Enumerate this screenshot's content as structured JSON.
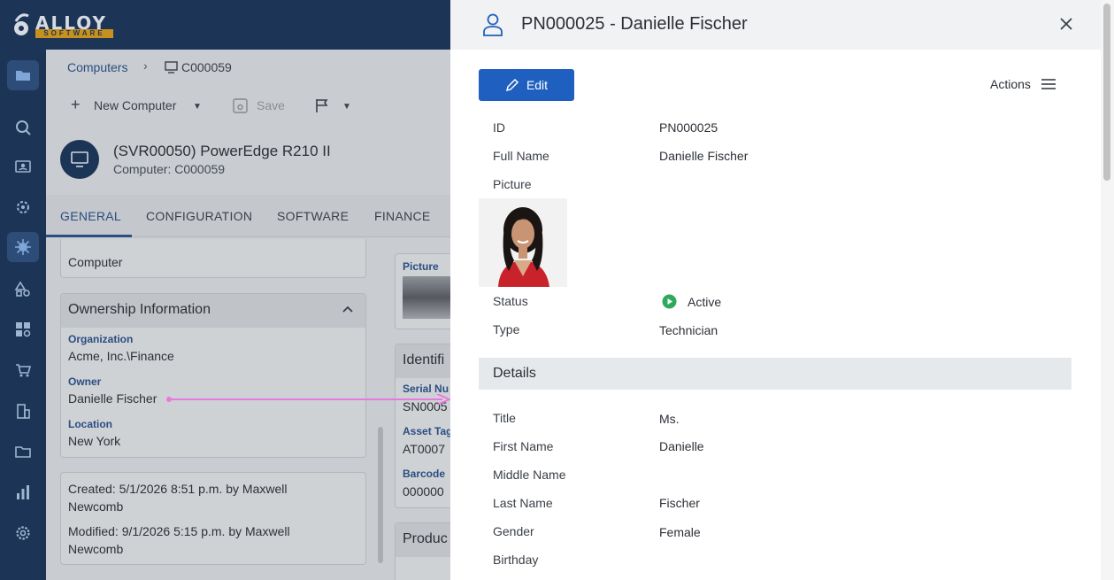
{
  "app": {
    "logo_text": "ALLOY",
    "logo_sub": "SOFTWARE"
  },
  "nav": {
    "icons": [
      "folder-icon",
      "search-icon",
      "contacts-icon",
      "settings-cog-icon",
      "virus-icon",
      "shapes-icon",
      "dashboard-icon",
      "cart-icon",
      "building-icon",
      "folder-outline-icon",
      "bar-chart-icon",
      "gear-icon"
    ]
  },
  "background": {
    "breadcrumb": {
      "root": "Computers",
      "current": "C000059"
    },
    "toolbar": {
      "new_label": "New Computer",
      "save_label": "Save"
    },
    "header": {
      "title": "(SVR00050) PowerEdge R210 II",
      "subtitle": "Computer: C000059"
    },
    "tabs": [
      "GENERAL",
      "CONFIGURATION",
      "SOFTWARE",
      "FINANCE"
    ],
    "top_card_value": "Computer",
    "ownership": {
      "title": "Ownership Information",
      "org_label": "Organization",
      "org_value": "Acme, Inc.\\Finance",
      "owner_label": "Owner",
      "owner_value": "Danielle Fischer",
      "location_label": "Location",
      "location_value": "New York"
    },
    "audit": {
      "created": "Created: 5/1/2026 8:51 p.m. by Maxwell",
      "created_2": "Newcomb",
      "modified": "Modified: 9/1/2026 5:15 p.m. by Maxwell",
      "modified_2": "Newcomb"
    },
    "right_col": {
      "picture_label": "Picture",
      "ident_title": "Identifi",
      "serial_label": "Serial Nu",
      "serial_value": "SN0005",
      "asset_label": "Asset Tag",
      "asset_value": "AT0007",
      "barcode_label": "Barcode",
      "barcode_value": "000000",
      "product_title": "Produc"
    }
  },
  "panel": {
    "title": "PN000025 - Danielle Fischer",
    "edit_label": "Edit",
    "actions_label": "Actions",
    "fields": {
      "id_label": "ID",
      "id_value": "PN000025",
      "fullname_label": "Full Name",
      "fullname_value": "Danielle Fischer",
      "picture_label": "Picture",
      "status_label": "Status",
      "status_value": "Active",
      "type_label": "Type",
      "type_value": "Technician"
    },
    "details_title": "Details",
    "details": {
      "title_label": "Title",
      "title_value": "Ms.",
      "first_label": "First Name",
      "first_value": "Danielle",
      "middle_label": "Middle Name",
      "last_label": "Last Name",
      "last_value": "Fischer",
      "gender_label": "Gender",
      "gender_value": "Female",
      "birthday_label": "Birthday"
    },
    "colors": {
      "accent": "#1f5fbf",
      "status_active": "#2eaa5c",
      "annotation_arrow": "#e879e0"
    }
  }
}
